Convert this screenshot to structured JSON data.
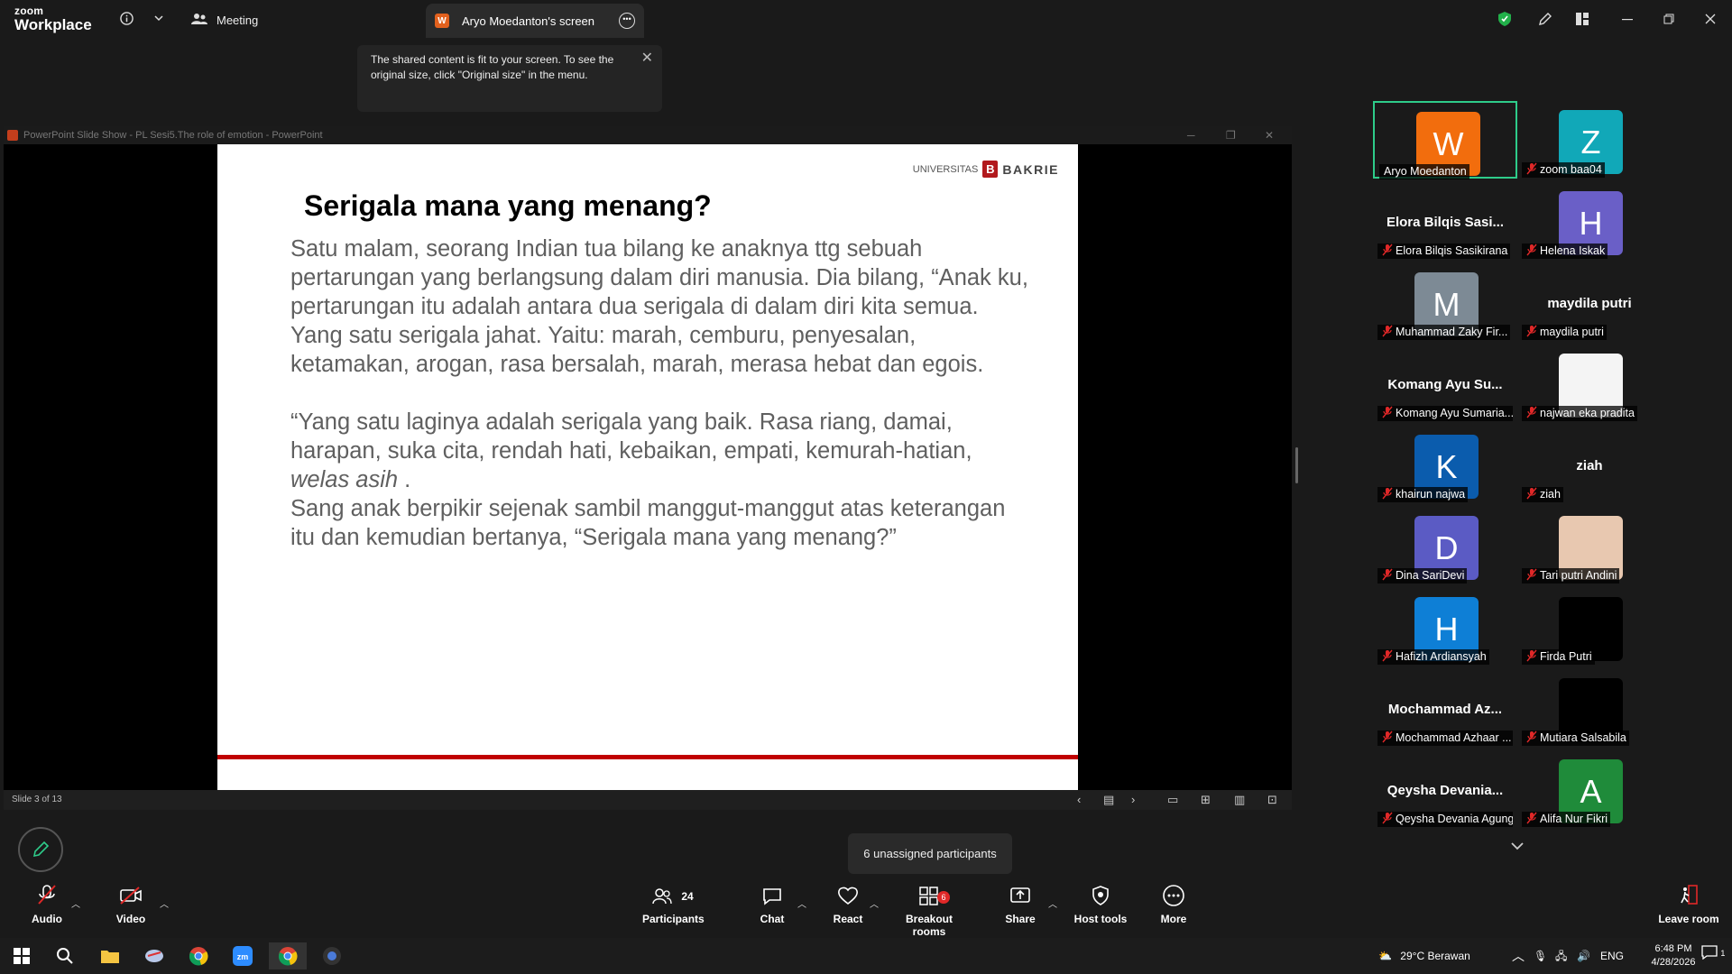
{
  "top_bar": {
    "logo_line1": "zoom",
    "logo_line2": "Workplace",
    "meeting_tab": "Meeting",
    "share_tab": "Aryo Moedanton's screen",
    "accent_green": "#2ecc8a"
  },
  "tooltip": {
    "text": "The shared content is fit to your screen. To see the original size, click \"Original size\" in the menu."
  },
  "powerpoint": {
    "window_title": "PowerPoint Slide Show  -  PL Sesi5.The role of emotion - PowerPoint",
    "slide_counter": "Slide 3 of 13",
    "logo_univ": "UNIVERSITAS",
    "logo_b": "B",
    "logo_bakrie": "BAKRIE",
    "slide_title": "Serigala mana yang menang?",
    "para1": "Satu malam, seorang Indian tua bilang ke anaknya ttg sebuah pertarungan yang berlangsung dalam diri manusia. Dia bilang, “Anak ku, pertarungan itu adalah antara dua serigala di dalam diri kita semua. Yang satu serigala jahat. Yaitu: marah, cemburu, penyesalan, ketamakan, arogan, rasa bersalah, marah, merasa hebat dan egois.",
    "para2": "“Yang satu laginya adalah serigala yang baik. Rasa riang, damai, harapan, suka cita, rendah hati, kebaikan, empati, kemurah-hatian,",
    "para2_italic": "welas asih",
    "para2_end": " .",
    "para3": "Sang anak berpikir sejenak sambil manggut-manggut atas keterangan itu dan kemudian bertanya, “Serigala mana yang menang?”"
  },
  "participants_gallery": [
    {
      "tile_name": "Aryo Moedanton",
      "avatar_letter": "W",
      "avatar_color": "#f26d0d",
      "show_mic_off": false,
      "active": true
    },
    {
      "tile_name": "zoom baa04",
      "avatar_letter": "Z",
      "avatar_color": "#11a8b8",
      "show_mic_off": true
    },
    {
      "tile_name": "Elora Bilqis Sasikirana",
      "big_name": "Elora Bilqis Sasi...",
      "show_mic_off": true
    },
    {
      "tile_name": "Helena Iskak",
      "avatar_letter": "H",
      "avatar_color": "#6a5fc7",
      "show_mic_off": true
    },
    {
      "tile_name": "Muhammad Zaky Fir...",
      "avatar_letter": "M",
      "avatar_color": "#7d8a95",
      "show_mic_off": true
    },
    {
      "tile_name": "maydila putri",
      "big_name": "maydila putri",
      "show_mic_off": true
    },
    {
      "tile_name": "Komang Ayu Sumaria...",
      "big_name": "Komang Ayu Su...",
      "show_mic_off": true
    },
    {
      "tile_name": "najwan eka pradita",
      "avatar_color": "#f4f4f4",
      "show_mic_off": true
    },
    {
      "tile_name": "khairun najwa",
      "avatar_letter": "K",
      "avatar_color": "#0b5cad",
      "show_mic_off": true
    },
    {
      "tile_name": "ziah",
      "big_name": "ziah",
      "show_mic_off": true
    },
    {
      "tile_name": "Dina SariDevi",
      "avatar_letter": "D",
      "avatar_color": "#5b5bc4",
      "show_mic_off": true
    },
    {
      "tile_name": "Tari putri Andini",
      "avatar_color": "#e8c8b0",
      "show_mic_off": true
    },
    {
      "tile_name": "Hafizh Ardiansyah",
      "avatar_letter": "H",
      "avatar_color": "#0e7fd6",
      "show_mic_off": true
    },
    {
      "tile_name": "Firda Putri",
      "avatar_color": "#000000",
      "show_mic_off": true
    },
    {
      "tile_name": "Mochammad Azhaar ...",
      "big_name": "Mochammad Az...",
      "show_mic_off": true
    },
    {
      "tile_name": "Mutiara Salsabila",
      "avatar_color": "#000000",
      "show_mic_off": true
    },
    {
      "tile_name": "Qeysha Devania Agung",
      "big_name": "Qeysha Devania...",
      "show_mic_off": true
    },
    {
      "tile_name": "Alifa Nur Fikri",
      "avatar_letter": "A",
      "avatar_color": "#1f8b3a",
      "show_mic_off": true
    }
  ],
  "unassigned_popup": "6 unassigned participants",
  "toolbar": {
    "audio": "Audio",
    "video": "Video",
    "participants": "Participants",
    "participants_count": "24",
    "chat": "Chat",
    "react": "React",
    "breakout": "Breakout rooms",
    "breakout_badge": "6",
    "share": "Share",
    "host_tools": "Host tools",
    "more": "More",
    "leave": "Leave room"
  },
  "taskbar": {
    "weather": "29°C  Berawan",
    "lang": "ENG",
    "time": "6:48 PM",
    "date": "4/28/2026",
    "notif_count": "1"
  }
}
